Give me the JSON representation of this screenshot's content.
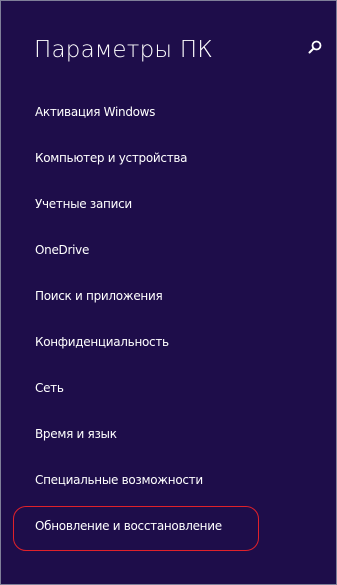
{
  "header": {
    "title": "Параметры ПК",
    "search_icon": "search-icon"
  },
  "menu": {
    "items": [
      {
        "label": "Активация Windows"
      },
      {
        "label": "Компьютер и устройства"
      },
      {
        "label": "Учетные записи"
      },
      {
        "label": "OneDrive"
      },
      {
        "label": "Поиск и приложения"
      },
      {
        "label": "Конфиденциальность"
      },
      {
        "label": "Сеть"
      },
      {
        "label": "Время и язык"
      },
      {
        "label": "Специальные возможности"
      },
      {
        "label": "Обновление и восстановление"
      }
    ]
  },
  "colors": {
    "background": "#1e0d4a",
    "text": "#ffffff",
    "highlight": "#e0212a"
  }
}
